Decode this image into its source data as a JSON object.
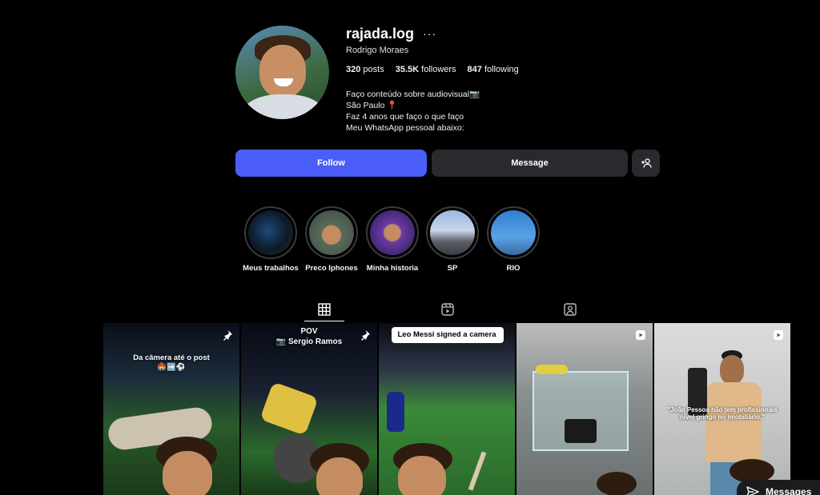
{
  "profile": {
    "username": "rajada.log",
    "full_name": "Rodrigo Moraes",
    "stats": {
      "posts": "320",
      "posts_label": "posts",
      "followers": "35.5K",
      "followers_label": "followers",
      "following": "847",
      "following_label": "following"
    },
    "bio": [
      "Faço conteúdo sobre audiovisual📷",
      "São Paulo 📍",
      "Faz 4 anos que faço o que faço",
      "Meu WhatsApp pessoal abaixo:"
    ]
  },
  "actions": {
    "follow": "Follow",
    "message": "Message"
  },
  "highlights": [
    {
      "label": "Meus trabalhos"
    },
    {
      "label": "Preco Iphones"
    },
    {
      "label": "Minha historia"
    },
    {
      "label": "SP"
    },
    {
      "label": "RIO"
    }
  ],
  "tabs": [
    "posts-grid-icon",
    "reels-icon",
    "tagged-icon"
  ],
  "posts": [
    {
      "caption": "Da câmera até o post",
      "caption2": "🏟️➡️⚽"
    },
    {
      "caption": "POV",
      "caption2": "📷 Sergio Ramos"
    },
    {
      "caption": "Leo Messi signed a camera"
    },
    {
      "caption": ""
    },
    {
      "caption": "\"João Pessoa não tem profissionais nível gringo no imobiliário.\""
    }
  ],
  "messages_label": "Messages",
  "colors": {
    "follow": "#4a5df9",
    "secondary_button": "#2a2a2e",
    "background": "#000000"
  }
}
